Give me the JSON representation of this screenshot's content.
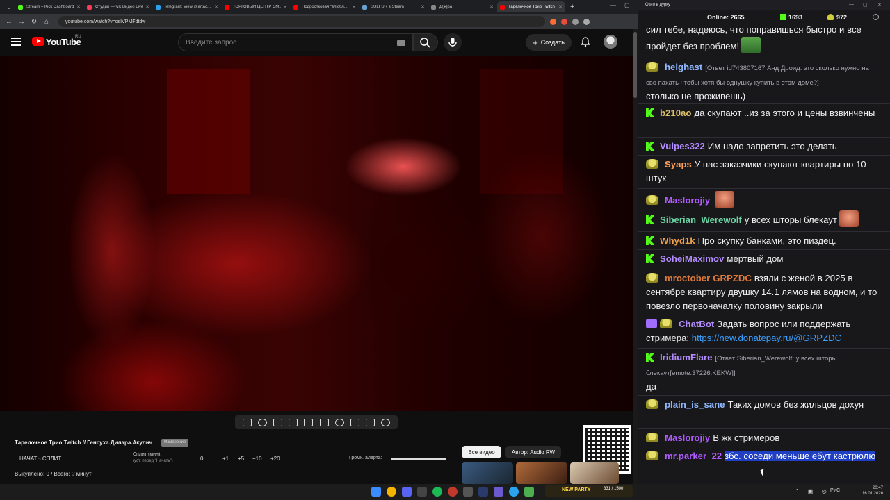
{
  "browser": {
    "tabs": [
      {
        "title": "Stream – Kick Dashboard",
        "color": "#53fc18"
      },
      {
        "title": "Студия — VK Видео Live",
        "color": "#ff3b5c"
      },
      {
        "title": "Telegram: View @artac...",
        "color": "#2aa3ef"
      },
      {
        "title": "ТОРГОВЫЙ ЦЕНТР СМ...",
        "color": "#ff0000"
      },
      {
        "title": "Подростковая \"влюбл...",
        "color": "#ff0000"
      },
      {
        "title": "SULFUR в Steam",
        "color": "#66a3d2"
      },
      {
        "title": "Д[ж]ра",
        "color": "#888888"
      },
      {
        "title": "Тарелочное Трио Twitch",
        "color": "#ff0000"
      }
    ],
    "url": "youtube.com/watch?v=osIVPMFdtdw"
  },
  "youtube": {
    "logo_text": "YouTube",
    "country": "RU",
    "search_placeholder": "Введите запрос",
    "create_label": "Создать"
  },
  "video": {
    "title": "Тарелочное Трио Twitch // Генсуха.Дилара.Акулич",
    "badge": "Измерение",
    "split_button": "НАЧАТЬ СПЛИТ",
    "split_label": "Сплит (мин):",
    "split_hint": "(уст. перед \"Начать\")",
    "split_value": "0",
    "split_steps": [
      "+1",
      "+5",
      "+10",
      "+20"
    ],
    "sold_text": "Выкуплено: 0 / Всего: ? минут",
    "alert_label": "Громк. алерта:",
    "all_videos": "Все видео",
    "author": "Автор: Audio RW"
  },
  "chat": {
    "window_title": "Окно в дурку",
    "online_label": "Online:",
    "online_count": "2665",
    "kick_count": "1693",
    "trovo_count": "972",
    "messages": [
      {
        "platform": "trovo",
        "user": "",
        "color": "#efeff1",
        "text": "сил тебе, надеюсь, что поправишься быстро и все пройдет без проблем!"
      },
      {
        "platform": "trovo",
        "user": "helghast",
        "color": "#8fb8ff",
        "reply": "[Ответ id743807167 Анд Дроид: это сколько нужно на сво пахать чтобы хотя бы однушку купить в этом доме?]",
        "text": "столько не проживешь)"
      },
      {
        "platform": "kick",
        "user": "b210ao",
        "color": "#e0c266",
        "text": "да скупают ..из за этого и цены взвинчены"
      },
      {
        "platform": "kick",
        "user": "Vulpes322",
        "color": "#b38cff",
        "text": "Им надо запретить это делать"
      },
      {
        "platform": "trovo",
        "user": "Syaps",
        "color": "#ff9d57",
        "text": "У нас заказчики скупают квартиры по 10 штук"
      },
      {
        "platform": "trovo",
        "user": "Maslorojiy",
        "color": "#b05cff",
        "text": ""
      },
      {
        "platform": "kick",
        "user": "Siberian_Werewolf",
        "color": "#6ad3a4",
        "text": "у всех шторы блекаут"
      },
      {
        "platform": "kick",
        "user": "Whyd1k",
        "color": "#f0a048",
        "text": "Про скупку банками, это пиздец."
      },
      {
        "platform": "kick",
        "user": "SoheiMaximov",
        "color": "#b38cff",
        "text": "мертвый дом"
      },
      {
        "platform": "trovo",
        "user": "mroctober",
        "color": "#e07a3a",
        "mention": "GRPZDC",
        "text": "взяли с женой в 2025 в сентябре квартиру двушку 14.1 лямов на водном, и то повезло первоначалку половину закрыли"
      },
      {
        "platform": "bot",
        "user": "ChatBot",
        "color": "#b38cff",
        "text": "Задать вопрос или поддержать стримера:",
        "link": "https://new.donatepay.ru/@GRPZDC"
      },
      {
        "platform": "kick",
        "user": "IridiumFlare",
        "color": "#b38cff",
        "reply": "[Ответ Siberian_Werewolf: у всех шторы блекаут[emote:37226:KEKW]]",
        "text": "да"
      },
      {
        "platform": "trovo",
        "user": "plain_is_sane",
        "color": "#8fb8ff",
        "text": "Таких домов без жильцов дохуя"
      },
      {
        "platform": "trovo",
        "user": "Maslorojiy",
        "color": "#b05cff",
        "text": "В жк стримеров"
      },
      {
        "platform": "trovo",
        "user": "mr.parker_22",
        "color": "#b05cff",
        "text": "збс. соседи меньше ебут кастрюлю",
        "highlight": true
      }
    ]
  },
  "taskbar": {
    "widget_label": "NEW PARTY",
    "widget_value": "331 / 1500",
    "lang": "РУС",
    "time": "20:47",
    "date": "16.01.2026"
  }
}
